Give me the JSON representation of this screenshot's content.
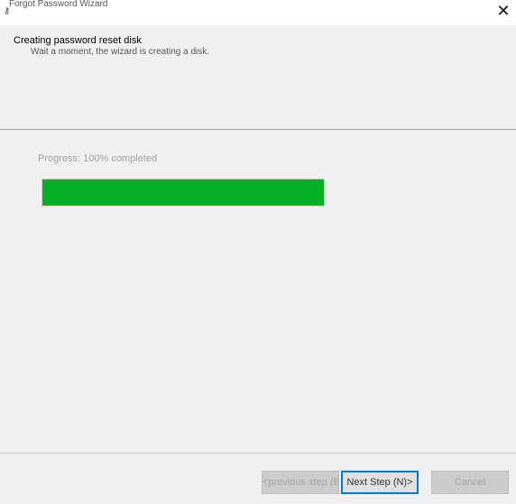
{
  "window": {
    "title": "Forgot Password Wizard",
    "app_icon": "key-icon",
    "close_glyph": "✕"
  },
  "header": {
    "title": "Creating password reset disk",
    "description": "Wait a moment, the wizard is creating a disk."
  },
  "progress": {
    "label": "Progress: 100% completed",
    "value_percent": 100,
    "color": "#06b025"
  },
  "buttons": {
    "previous": "<previous step (B)",
    "next": "Next Step (N)>",
    "cancel": "Cancel"
  }
}
